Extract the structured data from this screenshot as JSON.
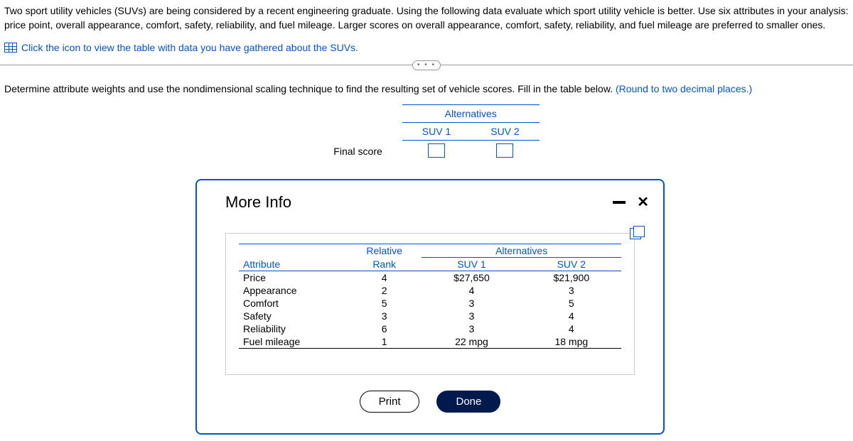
{
  "question": {
    "text": "Two sport utility vehicles (SUVs) are being considered by a recent engineering graduate. Using the following data evaluate which sport utility vehicle is better. Use six attributes in your analysis: price point, overall appearance, comfort, safety, reliability, and fuel mileage. Larger scores on overall appearance, comfort, safety, reliability, and fuel mileage are preferred to smaller ones.",
    "link": "Click the icon to view the table with data you have gathered about the SUVs.",
    "instruction": "Determine attribute weights and use the nondimensional scaling technique to find the resulting set of vehicle scores. Fill in the table below. ",
    "round_hint": "(Round to two decimal places.)"
  },
  "answer_table": {
    "alternatives": "Alternatives",
    "suv1": "SUV 1",
    "suv2": "SUV 2",
    "final_score": "Final score"
  },
  "pill": "• • •",
  "modal": {
    "title": "More Info",
    "headers": {
      "attribute": "Attribute",
      "relative": "Relative",
      "rank": "Rank",
      "alternatives": "Alternatives",
      "suv1": "SUV 1",
      "suv2": "SUV 2"
    },
    "rows": [
      {
        "attr": "Price",
        "rank": "4",
        "suv1": "$27,650",
        "suv2": "$21,900"
      },
      {
        "attr": "Appearance",
        "rank": "2",
        "suv1": "4",
        "suv2": "3"
      },
      {
        "attr": "Comfort",
        "rank": "5",
        "suv1": "3",
        "suv2": "5"
      },
      {
        "attr": "Safety",
        "rank": "3",
        "suv1": "3",
        "suv2": "4"
      },
      {
        "attr": "Reliability",
        "rank": "6",
        "suv1": "3",
        "suv2": "4"
      },
      {
        "attr": "Fuel mileage",
        "rank": "1",
        "suv1": "22 mpg",
        "suv2": "18 mpg"
      }
    ],
    "print": "Print",
    "done": "Done"
  }
}
